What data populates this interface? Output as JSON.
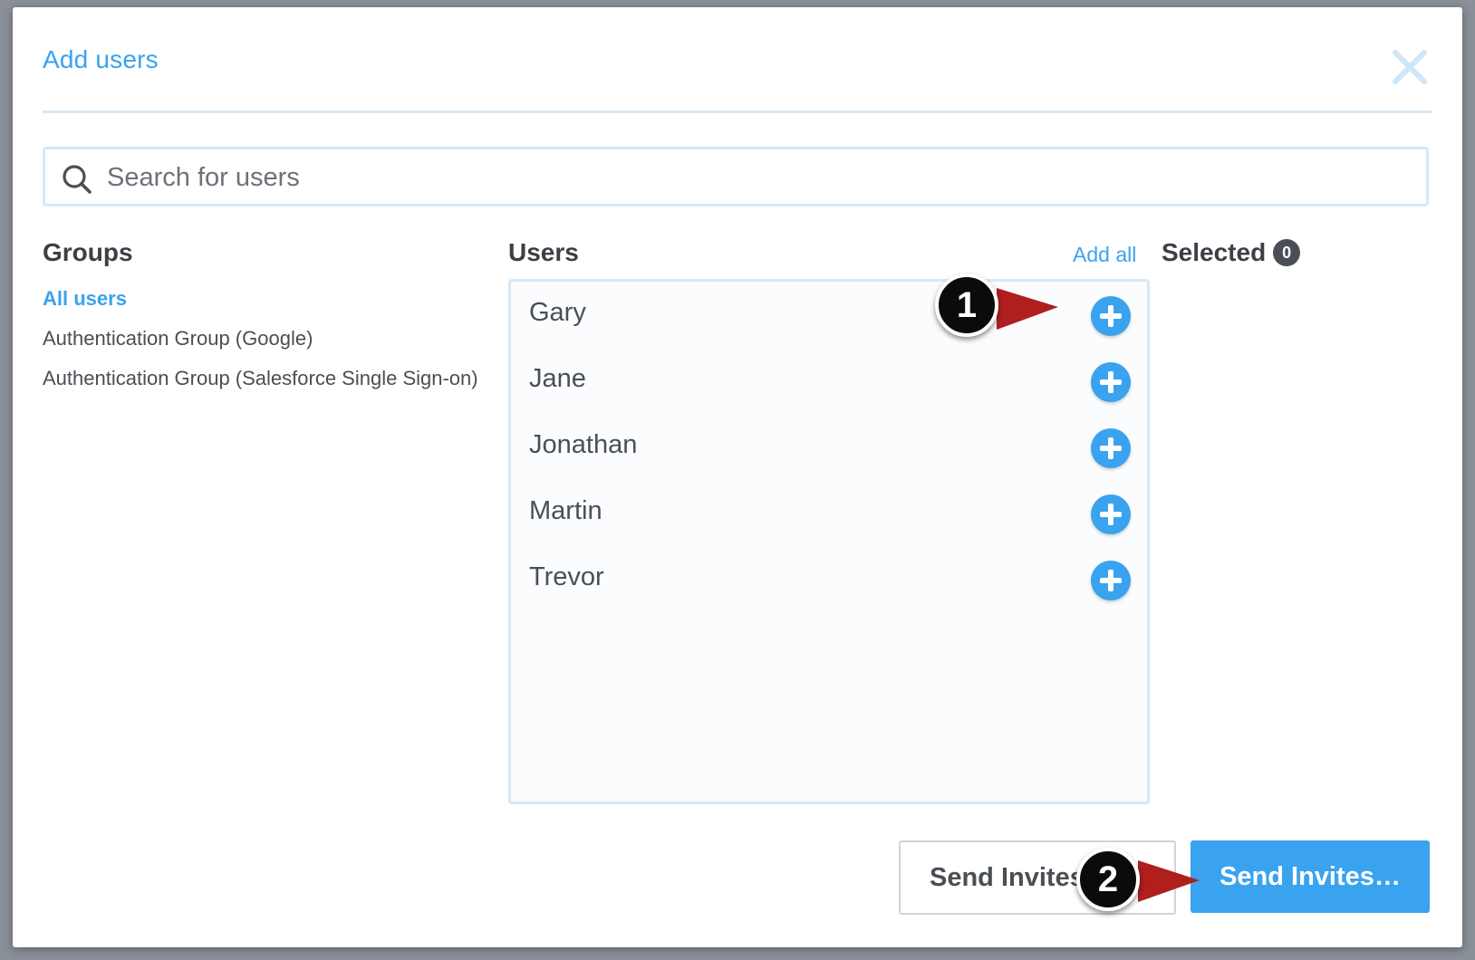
{
  "modal": {
    "title": "Add users",
    "close_icon": "close-x-icon"
  },
  "search": {
    "placeholder": "Search for users",
    "value": "",
    "icon": "search-icon"
  },
  "groups": {
    "heading": "Groups",
    "items": [
      {
        "label": "All users",
        "active": true
      },
      {
        "label": "Authentication Group (Google)",
        "active": false
      },
      {
        "label": "Authentication Group (Salesforce Single Sign-on)",
        "active": false
      }
    ]
  },
  "users": {
    "heading": "Users",
    "add_all_label": "Add all",
    "items": [
      {
        "name": "Gary"
      },
      {
        "name": "Jane"
      },
      {
        "name": "Jonathan"
      },
      {
        "name": "Martin"
      },
      {
        "name": "Trevor"
      }
    ]
  },
  "selected": {
    "heading": "Selected",
    "count": "0"
  },
  "footer": {
    "secondary_label": "Send Invites",
    "primary_label": "Send Invites…"
  },
  "annotations": {
    "callout_1": "1",
    "callout_2": "2",
    "callout_color": "#0b0b0b",
    "arrow_color": "#b01e1e"
  },
  "colors": {
    "accent": "#3aa3ef",
    "border": "#d6e9f7",
    "text": "#4a4f55"
  }
}
